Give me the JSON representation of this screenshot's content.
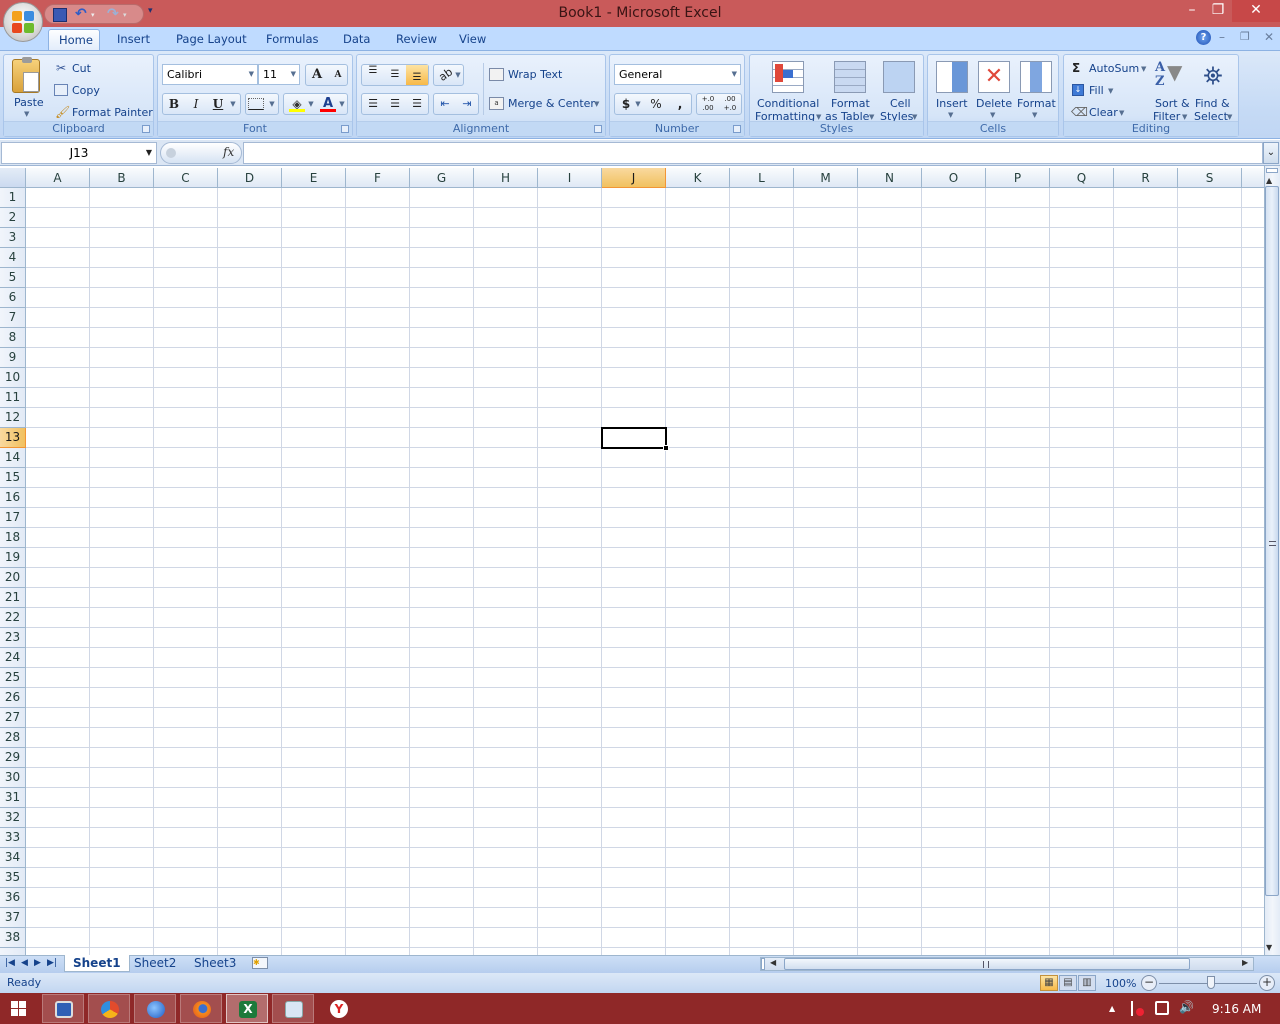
{
  "window": {
    "title": "Book1 - Microsoft Excel",
    "controls": {
      "minimize": "–",
      "restore": "❐",
      "close": "✕"
    }
  },
  "quick_access": {
    "save_icon": "save-icon",
    "undo_icon": "undo-icon",
    "redo_icon": "redo-icon",
    "customize": "▾"
  },
  "ribbon_tabs": [
    {
      "label": "Home",
      "active": true
    },
    {
      "label": "Insert"
    },
    {
      "label": "Page Layout"
    },
    {
      "label": "Formulas"
    },
    {
      "label": "Data"
    },
    {
      "label": "Review"
    },
    {
      "label": "View"
    }
  ],
  "ribbon_right": {
    "help": "?",
    "minimize": "–",
    "restore": "❐",
    "close": "✕"
  },
  "groups": {
    "clipboard": {
      "label": "Clipboard",
      "paste": "Paste",
      "cut": "Cut",
      "copy": "Copy",
      "format_painter": "Format Painter"
    },
    "font": {
      "label": "Font",
      "font_name": "Calibri",
      "font_size": "11",
      "grow": "A",
      "shrink": "A",
      "bold": "B",
      "italic": "I",
      "underline": "U",
      "fill_color": "#ffff00",
      "font_color": "#ff0000"
    },
    "alignment": {
      "label": "Alignment",
      "wrap_text": "Wrap Text",
      "merge_center": "Merge & Center"
    },
    "number": {
      "label": "Number",
      "format": "General",
      "currency": "$",
      "percent": "%",
      "comma": ",",
      "inc_decimal": "+.0 .00",
      "dec_decimal": ".00 +.0"
    },
    "styles": {
      "label": "Styles",
      "conditional_1": "Conditional",
      "conditional_2": "Formatting",
      "format_table_1": "Format",
      "format_table_2": "as Table",
      "cell_styles_1": "Cell",
      "cell_styles_2": "Styles"
    },
    "cells": {
      "label": "Cells",
      "insert": "Insert",
      "delete": "Delete",
      "format": "Format"
    },
    "editing": {
      "label": "Editing",
      "autosum": "AutoSum",
      "fill": "Fill",
      "clear": "Clear",
      "sort_1": "Sort &",
      "sort_2": "Filter",
      "find_1": "Find &",
      "find_2": "Select"
    }
  },
  "formula_bar": {
    "name_box": "J13",
    "fx": "fx",
    "value": ""
  },
  "sheet": {
    "columns": [
      "A",
      "B",
      "C",
      "D",
      "E",
      "F",
      "G",
      "H",
      "I",
      "J",
      "K",
      "L",
      "M",
      "N",
      "O",
      "P",
      "Q",
      "R",
      "S"
    ],
    "rows": [
      "1",
      "2",
      "3",
      "4",
      "5",
      "6",
      "7",
      "8",
      "9",
      "10",
      "11",
      "12",
      "13",
      "14",
      "15",
      "16",
      "17",
      "18",
      "19",
      "20",
      "21",
      "22",
      "23",
      "24",
      "25",
      "26",
      "27",
      "28",
      "29",
      "30",
      "31",
      "32",
      "33",
      "34",
      "35",
      "36",
      "37",
      "38"
    ],
    "active_cell": {
      "column": "J",
      "row": "13"
    }
  },
  "sheet_tabs": [
    {
      "label": "Sheet1",
      "active": true
    },
    {
      "label": "Sheet2"
    },
    {
      "label": "Sheet3"
    }
  ],
  "status_bar": {
    "status": "Ready",
    "zoom": "100%",
    "zoom_level": 1.0
  },
  "taskbar": {
    "apps": [
      {
        "name": "start",
        "icon": "windows-start-icon"
      },
      {
        "name": "app-1",
        "icon": "monitor-search-icon"
      },
      {
        "name": "app-2",
        "icon": "chrome-like-icon"
      },
      {
        "name": "app-3",
        "icon": "blue-globe-icon"
      },
      {
        "name": "firefox",
        "icon": "firefox-icon"
      },
      {
        "name": "excel",
        "icon": "excel-icon",
        "active": true
      },
      {
        "name": "app-6",
        "icon": "network-monitor-icon"
      },
      {
        "name": "yandex",
        "icon": "yandex-icon"
      }
    ],
    "clock": "9:16 AM",
    "tray_arrow": "▲"
  }
}
